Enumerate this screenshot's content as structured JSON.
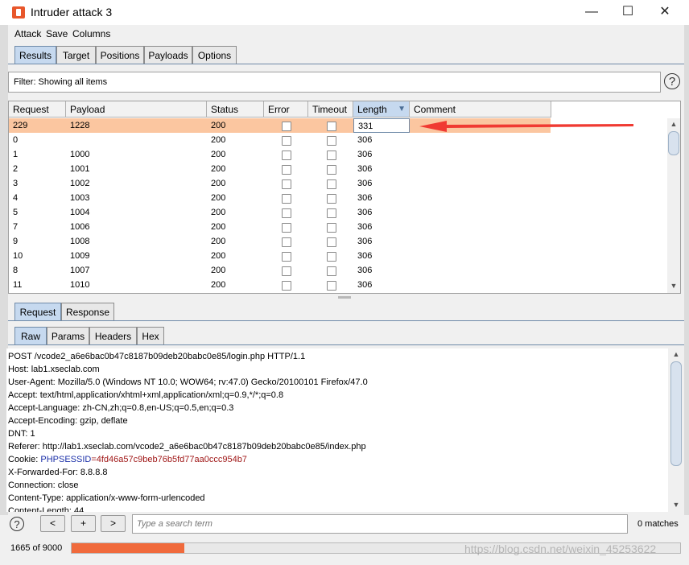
{
  "window": {
    "title": "Intruder attack 3",
    "controls": {
      "minimize": "—",
      "maximize": "☐",
      "close": "✕"
    }
  },
  "menu": [
    "Attack",
    "Save",
    "Columns"
  ],
  "tabs": [
    "Results",
    "Target",
    "Positions",
    "Payloads",
    "Options"
  ],
  "filter": {
    "text": "Filter: Showing all items",
    "help": "?"
  },
  "table": {
    "columns": [
      "Request",
      "Payload",
      "Status",
      "Error",
      "Timeout",
      "Length",
      "Comment"
    ],
    "sorted_column": "Length",
    "rows": [
      {
        "request": "229",
        "payload": "1228",
        "status": "200",
        "length": "331",
        "selected": true
      },
      {
        "request": "0",
        "payload": "",
        "status": "200",
        "length": "306"
      },
      {
        "request": "1",
        "payload": "1000",
        "status": "200",
        "length": "306"
      },
      {
        "request": "2",
        "payload": "1001",
        "status": "200",
        "length": "306"
      },
      {
        "request": "3",
        "payload": "1002",
        "status": "200",
        "length": "306"
      },
      {
        "request": "4",
        "payload": "1003",
        "status": "200",
        "length": "306"
      },
      {
        "request": "5",
        "payload": "1004",
        "status": "200",
        "length": "306"
      },
      {
        "request": "7",
        "payload": "1006",
        "status": "200",
        "length": "306"
      },
      {
        "request": "9",
        "payload": "1008",
        "status": "200",
        "length": "306"
      },
      {
        "request": "10",
        "payload": "1009",
        "status": "200",
        "length": "306"
      },
      {
        "request": "8",
        "payload": "1007",
        "status": "200",
        "length": "306"
      },
      {
        "request": "11",
        "payload": "1010",
        "status": "200",
        "length": "306"
      }
    ]
  },
  "detail_tabs": [
    "Request",
    "Response"
  ],
  "view_tabs": [
    "Raw",
    "Params",
    "Headers",
    "Hex"
  ],
  "request_lines": [
    "POST /vcode2_a6e6bac0b47c8187b09deb20babc0e85/login.php HTTP/1.1",
    "Host: lab1.xseclab.com",
    "User-Agent: Mozilla/5.0 (Windows NT 10.0; WOW64; rv:47.0) Gecko/20100101 Firefox/47.0",
    "Accept: text/html,application/xhtml+xml,application/xml;q=0.9,*/*;q=0.8",
    "Accept-Language: zh-CN,zh;q=0.8,en-US;q=0.5,en;q=0.3",
    "Accept-Encoding: gzip, deflate",
    "DNT: 1",
    "Referer: http://lab1.xseclab.com/vcode2_a6e6bac0b47c8187b09deb20babc0e85/index.php"
  ],
  "cookie": {
    "prefix": "Cookie: ",
    "name": "PHPSESSID",
    "value": "=4fd46a57c9beb76b5fd77aa0ccc954b7"
  },
  "request_lines_after": [
    "X-Forwarded-For: 8.8.8.8",
    "Connection: close",
    "Content-Type: application/x-www-form-urlencoded",
    "Content-Length: 44"
  ],
  "search": {
    "placeholder": "Type a search term",
    "matches": "0 matches",
    "buttons": [
      "<",
      "+",
      ">"
    ]
  },
  "progress": {
    "text": "1665 of 9000",
    "done": 1665,
    "total": 9000
  },
  "watermark": "https://blog.csdn.net/weixin_45253622",
  "colors": {
    "selected_row": "#fbc6a0",
    "active_tab": "#c6d9ef",
    "progress": "#f06a3c",
    "annotation_arrow": "#f03a32",
    "cookie_name": "#1a2fa8",
    "cookie_value": "#a01818"
  }
}
